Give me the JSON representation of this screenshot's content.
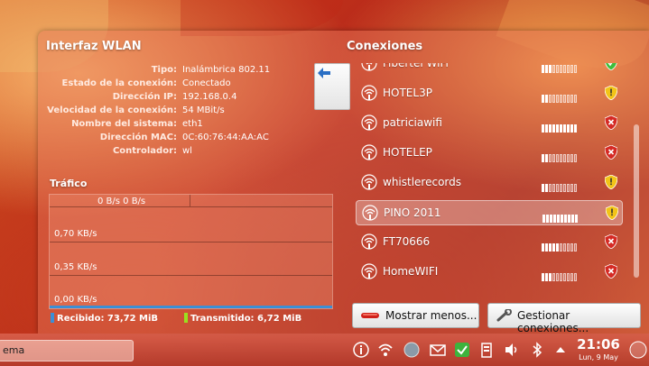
{
  "wlan": {
    "title": "Interfaz WLAN",
    "rows": [
      {
        "label": "Tipo:",
        "value": "Inalámbrica 802.11"
      },
      {
        "label": "Estado de la conexión:",
        "value": "Conectado"
      },
      {
        "label": "Dirección IP:",
        "value": "192.168.0.4"
      },
      {
        "label": "Velocidad de la conexión:",
        "value": "54 MBit/s"
      },
      {
        "label": "Nombre del sistema:",
        "value": "eth1"
      },
      {
        "label": "Dirección MAC:",
        "value": "0C:60:76:44:AA:AC"
      },
      {
        "label": "Controlador:",
        "value": "wl"
      }
    ]
  },
  "traffic": {
    "title": "Tráfico",
    "top_label": "0 B/s 0 B/s",
    "levels": [
      "0,70 KB/s",
      "0,35 KB/s",
      "0,00 KB/s"
    ],
    "received_label": "Recibido: 73,72 MiB",
    "transmitted_label": "Transmitido: 6,72 MiB",
    "received_color": "#3b8fd6",
    "transmitted_color": "#9adf1f"
  },
  "connections": {
    "title": "Conexiones",
    "networks": [
      {
        "name": "Fibertel WiFi",
        "strength": 3,
        "security": "green"
      },
      {
        "name": "HOTEL3P",
        "strength": 2,
        "security": "yellow"
      },
      {
        "name": "patriciawifi",
        "strength": 10,
        "security": "red"
      },
      {
        "name": "HOTELEP",
        "strength": 2,
        "security": "red"
      },
      {
        "name": "whistlerecords",
        "strength": 2,
        "security": "yellow"
      },
      {
        "name": "PINO 2011",
        "strength": 10,
        "security": "yellow",
        "selected": true
      },
      {
        "name": "FT70666",
        "strength": 5,
        "security": "red"
      },
      {
        "name": "HomeWIFI",
        "strength": 3,
        "security": "red"
      }
    ],
    "show_less_label": "Mostrar menos...",
    "manage_label": "Gestionar conexiones..."
  },
  "taskbar": {
    "input_text": "ema",
    "time": "21:06",
    "date": "Lun, 9 May"
  }
}
